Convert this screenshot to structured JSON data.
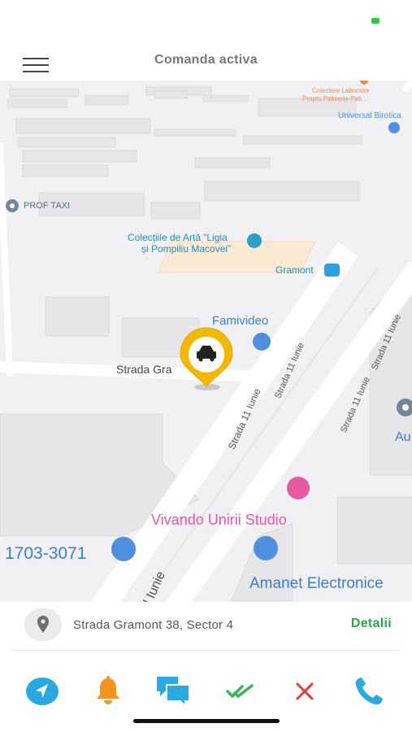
{
  "header": {
    "title": "Comanda activa"
  },
  "map": {
    "pois": {
      "colectare": "Colectare Laborator",
      "colectare_sub": "Proptu Patiserie Pati...",
      "universal": "Universal Birotica",
      "prof_taxi": "PROF TAXI",
      "colectii_l1": "Colecțiile de Artă “Ligia",
      "colectii_l2": "și Pompiliu Macovei”",
      "gramont": "Gramont",
      "famivideo": "Famivideo",
      "vivando": "Vivando Unirii Studio",
      "phone": "1703-3071",
      "amanet": "Amanet Electronice",
      "au": "Au"
    },
    "streets": {
      "strada_gramont": "Strada Gra",
      "s11_a": "Strada 11 Iunie",
      "s11_b": "Strada 11 Iunie",
      "s11_c": "Strada 11 Iunie",
      "s11_d": "Strada 11 Iunie",
      "iunie": "l Iunie"
    }
  },
  "address_card": {
    "address": "Strada Gramont 38, Sector 4",
    "details_label": "Detalii"
  },
  "colors": {
    "accent_blue": "#29a9e1",
    "bell_orange": "#f7931e",
    "check_green": "#3cb55a",
    "close_red": "#e53935",
    "marker_yellow": "#f5b800",
    "details_green": "#2aa84a"
  }
}
